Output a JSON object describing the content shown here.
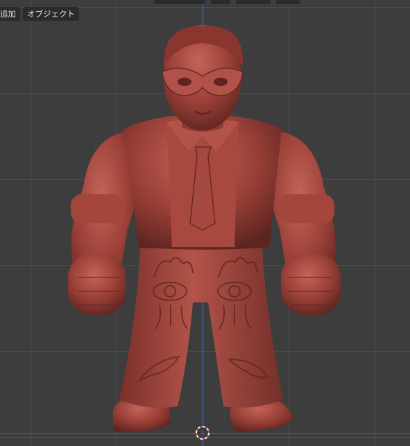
{
  "header": {
    "add_label": "追加",
    "object_label": "オブジェクト"
  },
  "viewport": {
    "background": "#3d3d3d",
    "axis_y_color": "#4a7fcf",
    "axis_x_color": "#b84a4a",
    "model_color": "#9a4038"
  },
  "icons": {
    "cursor": "3d-cursor-icon"
  }
}
